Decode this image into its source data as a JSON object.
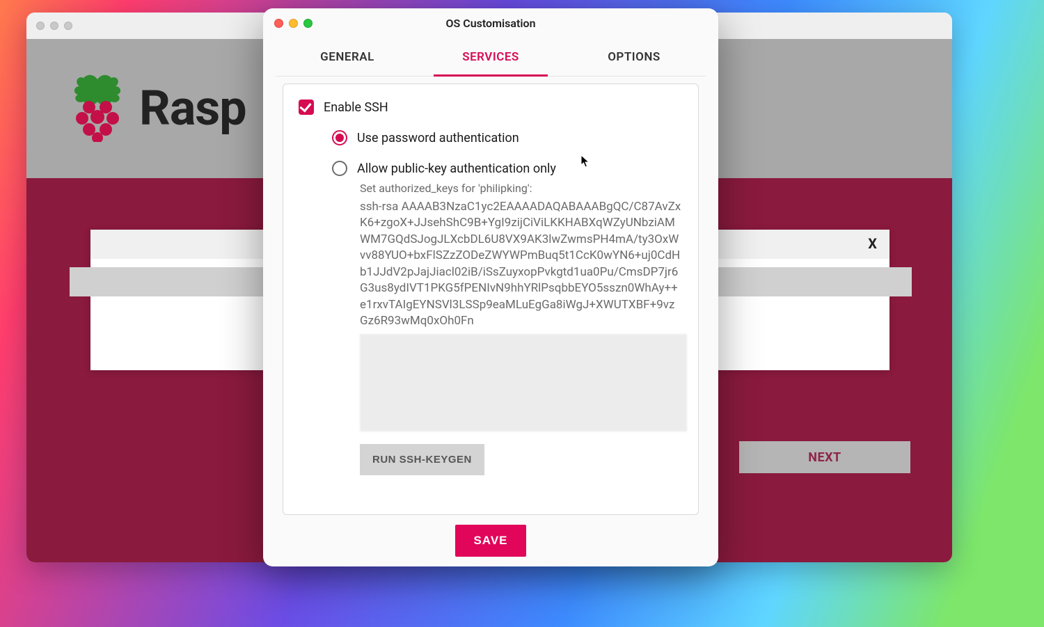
{
  "bg": {
    "brand_text": "Rasp",
    "card_close": "X",
    "next_label": "NEXT"
  },
  "modal": {
    "title": "OS Customisation",
    "tabs": {
      "general": "GENERAL",
      "services": "SERVICES",
      "options": "OPTIONS"
    },
    "enable_ssh_label": "Enable SSH",
    "auth": {
      "password_label": "Use password authentication",
      "publickey_label": "Allow public-key authentication only"
    },
    "authorized_keys_caption": "Set authorized_keys for 'philipking':",
    "ssh_key": "ssh-rsa AAAAB3NzaC1yc2EAAAADAQABAAABgQC/C87AvZxK6+zgoX+JJsehShC9B+YgI9zijCiViLKKHABXqWZyUNbziAMWM7GQdSJogJLXcbDL6U8VX9AK3lwZwmsPH4mA/ty3OxWvv88YUO+bxFlSZzZODeZWYWPmBuq5t1CcK0wYN6+uj0CdHb1JJdV2pJajJiacl02iB/iSsZuyxopPvkgtd1ua0Pu/CmsDP7jr6G3us8ydIVT1PKG5fPENIvN9hhYRlPsqbbEYO5sszn0WhAy++e1rxvTAIgEYNSVl3LSSp9eaMLuEgGa8iWgJ+XWUTXBF+9vzGz6R93wMq0xOh0Fn",
    "keygen_label": "RUN SSH-KEYGEN",
    "save_label": "SAVE"
  },
  "colors": {
    "accent": "#d60b52"
  }
}
